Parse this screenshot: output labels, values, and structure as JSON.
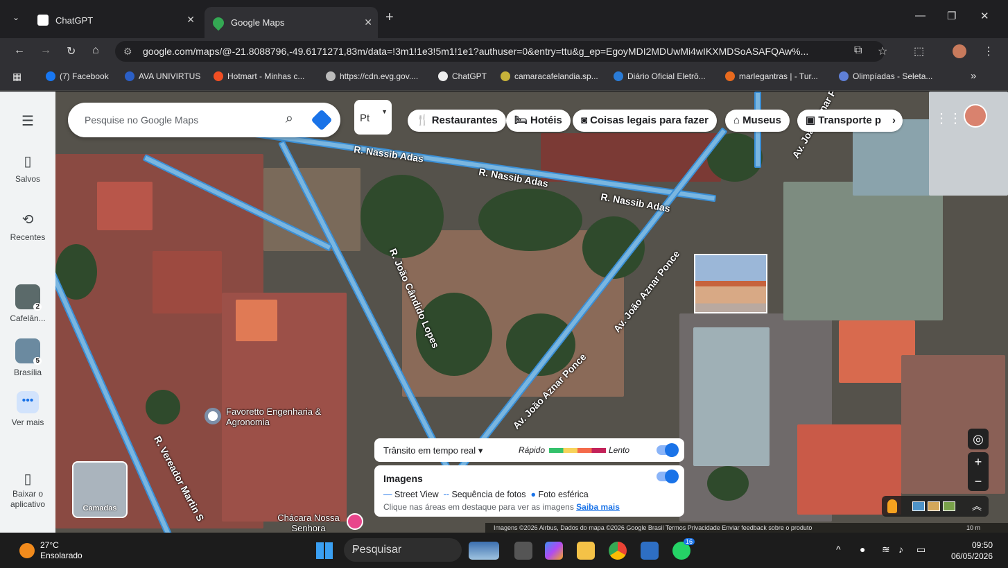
{
  "browser": {
    "tabs": [
      {
        "title": "ChatGPT"
      },
      {
        "title": "Google Maps"
      }
    ],
    "url": "google.com/maps/@-21.8088796,-49.6171271,83m/data=!3m1!1e3!5m1!1e1?authuser=0&entry=ttu&g_ep=EgoyMDI2MDUwMi4wIKXMDSoASAFQAw%...",
    "bookmarks": [
      "(7) Facebook",
      "AVA UNIVIRTUS",
      "Hotmart - Minhas c...",
      "https://cdn.evg.gov....",
      "ChatGPT",
      "camaracafelandia.sp...",
      "Diário Oficial Eletrô...",
      "marlegantras | - Tur...",
      "Olimpíadas - Seleta..."
    ]
  },
  "sidebar": {
    "saved": "Salvos",
    "recent": "Recentes",
    "recent_items": [
      {
        "label": "Cafelân...",
        "badge": "2"
      },
      {
        "label": "Brasília",
        "badge": "5"
      }
    ],
    "more": "Ver mais",
    "download": "Baixar o aplicativo"
  },
  "search": {
    "placeholder": "Pesquise no Google Maps",
    "lang_btn": "Pt"
  },
  "chips": [
    "Restaurantes",
    "Hotéis",
    "Coisas legais para fazer",
    "Museus",
    "Transporte p"
  ],
  "map": {
    "streets": [
      "R. Nassib Adas",
      "R. Nassib Adas",
      "R. Nassib Adas",
      "R. João Cândido Lopes",
      "Av. João Aznar Ponce",
      "Av. João Aznar Ponce",
      "Av. João Aznar Ponce",
      "R. Vereador Martin S"
    ],
    "places": {
      "favoretto": "Favoretto Engenharia & Agronomia",
      "chacara": "Chácara Nossa Senhora Aparecida"
    },
    "layers_label": "Camadas"
  },
  "traffic": {
    "label": "Trânsito em tempo real",
    "fast": "Rápido",
    "slow": "Lento"
  },
  "images": {
    "title": "Imagens",
    "street_view": "Street View",
    "photo_sequence": "Sequência de fotos",
    "sphere": "Foto esférica",
    "hint": "Clique nas áreas em destaque para ver as imagens",
    "learn_more": "Saiba mais"
  },
  "footer": {
    "text": "Imagens ©2026 Airbus, Dados do mapa ©2026 Google   Brasil   Termos   Privacidade   Enviar feedback sobre o produto",
    "scale": "10 m"
  },
  "taskbar": {
    "temp": "27°C",
    "weather": "Ensolarado",
    "search": "Pesquisar",
    "whatsapp_badge": "16",
    "time": "09:50",
    "date": "06/05/2026"
  },
  "colors": {
    "accent": "#1a73e8",
    "road": "#7ab6e0",
    "road_border": "#3a8fd6"
  }
}
